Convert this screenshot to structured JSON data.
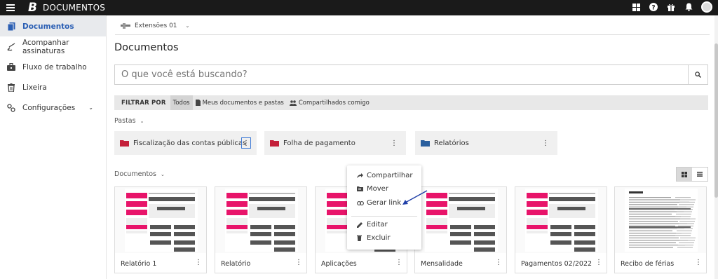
{
  "app": {
    "logo": "B",
    "title": "DOCUMENTOS"
  },
  "topbar_icons": [
    "apps-grid-icon",
    "help-icon",
    "gift-icon",
    "bell-icon",
    "avatar"
  ],
  "sidebar": {
    "items": [
      {
        "label": "Documentos",
        "icon": "document-icon",
        "active": true
      },
      {
        "label": "Acompanhar assinaturas",
        "icon": "signature-icon"
      },
      {
        "label": "Fluxo de trabalho",
        "icon": "briefcase-icon"
      },
      {
        "label": "Lixeira",
        "icon": "trash-icon"
      },
      {
        "label": "Configurações",
        "icon": "settings-icon",
        "chevron": "⌄"
      }
    ]
  },
  "extension": {
    "label": "Extensões 01",
    "chevron": "⌄"
  },
  "page_title": "Documentos",
  "search": {
    "placeholder": "O que você está buscando?"
  },
  "filter": {
    "label": "FILTRAR POR",
    "options": [
      "Todos",
      "Meus documentos e pastas",
      "Compartilhados comigo"
    ],
    "selected": "Todos"
  },
  "folders_section": {
    "label": "Pastas",
    "chevron": "⌄"
  },
  "folders": [
    {
      "name": "Fiscalização das contas públicas",
      "color": "#c4203a"
    },
    {
      "name": "Folha de pagamento",
      "color": "#c4203a"
    },
    {
      "name": "Relatórios",
      "color": "#2a5f9e"
    }
  ],
  "docs_section": {
    "label": "Documentos",
    "chevron": "⌄"
  },
  "documents": [
    {
      "name": "Relatório 1"
    },
    {
      "name": "Relatório"
    },
    {
      "name": "Aplicações"
    },
    {
      "name": "Mensalidade"
    },
    {
      "name": "Pagamentos 02/2022"
    },
    {
      "name": "Recibo de férias"
    }
  ],
  "context_menu": {
    "items": [
      "Compartilhar",
      "Mover",
      "Gerar link",
      "Editar",
      "Excluir"
    ]
  },
  "colors": {
    "accent": "#2b5fb4",
    "topbar": "#1a1a1a",
    "thumb_pink": "#e8146a",
    "thumb_dark": "#555555",
    "arrow": "#1f3fa8"
  }
}
